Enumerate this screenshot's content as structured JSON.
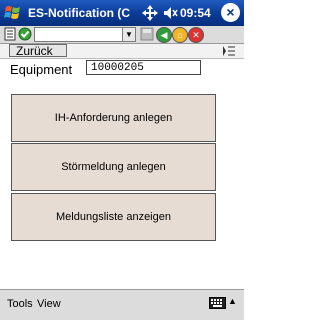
{
  "title_bar": {
    "app_title": "ES-Notification (CEI",
    "time": "09:54",
    "close_label": "×"
  },
  "toolbar": {
    "url_value": ""
  },
  "nav": {
    "back_label": "Zurück"
  },
  "form": {
    "equipment_label": "Equipment",
    "equipment_value": "10000205"
  },
  "actions": [
    {
      "label": "IH-Anforderung anlegen"
    },
    {
      "label": "Störmeldung anlegen"
    },
    {
      "label": "Meldungsliste anzeigen"
    }
  ],
  "bottom_bar": {
    "tools_label": "Tools",
    "view_label": "View"
  },
  "colors": {
    "titlebar": "#0a3a95",
    "button_bg": "#e7dcd3",
    "bar_bg": "#dcdcdc"
  }
}
